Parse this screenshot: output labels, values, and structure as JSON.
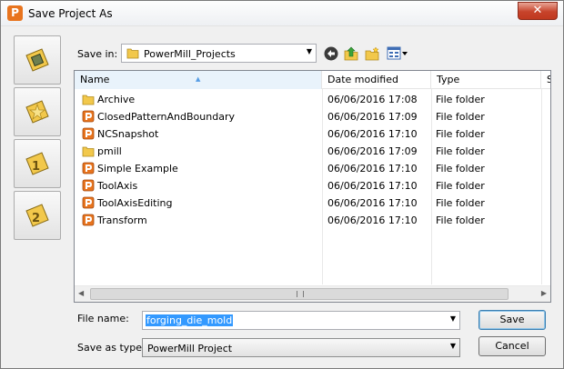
{
  "window": {
    "title": "Save Project As",
    "app_icon_letter": "P",
    "close_label": "✕"
  },
  "places": [
    {
      "name": "place-recent"
    },
    {
      "name": "place-favorites"
    },
    {
      "name": "place-location-1"
    },
    {
      "name": "place-location-2"
    }
  ],
  "savein": {
    "label": "Save in:",
    "value": "PowerMill_Projects"
  },
  "columns": {
    "name": "Name",
    "date": "Date modified",
    "type": "Type",
    "size": "Si"
  },
  "files": [
    {
      "name": "Archive",
      "date": "06/06/2016 17:08",
      "type": "File folder",
      "icon": "folder-icon"
    },
    {
      "name": "ClosedPatternAndBoundary",
      "date": "06/06/2016 17:09",
      "type": "File folder",
      "icon": "powermill-project-icon"
    },
    {
      "name": "NCSnapshot",
      "date": "06/06/2016 17:10",
      "type": "File folder",
      "icon": "powermill-project-icon"
    },
    {
      "name": "pmill",
      "date": "06/06/2016 17:09",
      "type": "File folder",
      "icon": "folder-icon"
    },
    {
      "name": "Simple Example",
      "date": "06/06/2016 17:10",
      "type": "File folder",
      "icon": "powermill-project-icon"
    },
    {
      "name": "ToolAxis",
      "date": "06/06/2016 17:10",
      "type": "File folder",
      "icon": "powermill-project-icon"
    },
    {
      "name": "ToolAxisEditing",
      "date": "06/06/2016 17:10",
      "type": "File folder",
      "icon": "powermill-project-icon"
    },
    {
      "name": "Transform",
      "date": "06/06/2016 17:10",
      "type": "File folder",
      "icon": "powermill-project-icon"
    }
  ],
  "filename": {
    "label": "File name:",
    "value": "forging_die_mold"
  },
  "savetype": {
    "label": "Save as type:",
    "value": "PowerMill Project"
  },
  "buttons": {
    "save": "Save",
    "cancel": "Cancel"
  },
  "colors": {
    "selection": "#3399ff",
    "folder": "#f2c84b",
    "project": "#e8741e"
  }
}
